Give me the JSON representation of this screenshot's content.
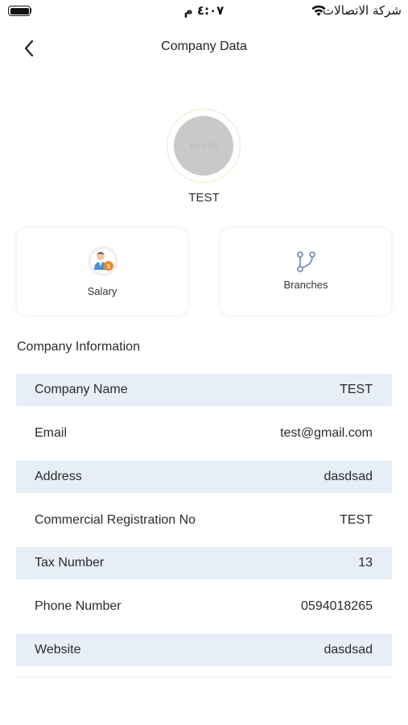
{
  "status_bar": {
    "time": "٤:٠٧ م",
    "carrier": "شركة الاتصالات"
  },
  "header": {
    "title": "Company Data"
  },
  "profile": {
    "placeholder_text": "120 x 120",
    "name": "TEST"
  },
  "cards": {
    "salary_label": "Salary",
    "branches_label": "Branches"
  },
  "info": {
    "section_title": "Company Information",
    "rows": [
      {
        "label": "Company Name",
        "value": "TEST"
      },
      {
        "label": "Email",
        "value": "test@gmail.com"
      },
      {
        "label": "Address",
        "value": "dasdsad"
      },
      {
        "label": "Commercial Registration No",
        "value": "TEST"
      },
      {
        "label": "Tax Number",
        "value": "13"
      },
      {
        "label": "Phone Number",
        "value": "0594018265"
      },
      {
        "label": "Website",
        "value": "dasdsad"
      }
    ]
  },
  "colors": {
    "row_shade": "#e7eef8",
    "avatar_gray": "#c9c9c9",
    "icon_blue": "#7d8fb6"
  }
}
